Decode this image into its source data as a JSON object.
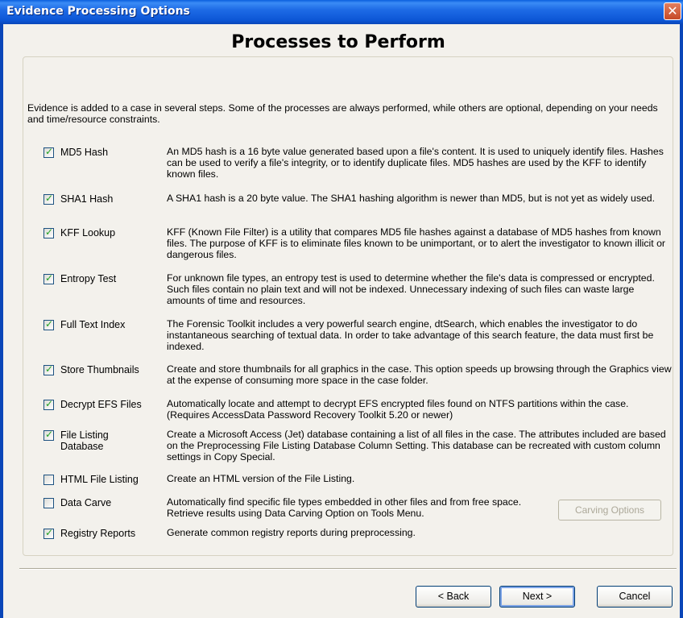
{
  "window": {
    "title": "Evidence Processing Options",
    "close_glyph": "✕"
  },
  "heading": "Processes to Perform",
  "intro": "Evidence is added to a case in several steps. Some of the processes are always performed, while others are optional, depending on your needs and time/resource constraints.",
  "options": [
    {
      "label": "MD5 Hash",
      "checked": true,
      "mark": "✓",
      "description": "An MD5 hash is a 16 byte value generated based upon a file's content. It is used to uniquely identify files. Hashes can be used to verify a file's integrity, or to identify duplicate files. MD5 hashes are used by the KFF to identify known files."
    },
    {
      "label": "SHA1 Hash",
      "checked": true,
      "mark": "✓",
      "description": "A SHA1 hash is a 20 byte value. The SHA1 hashing algorithm is newer than MD5, but is not yet as widely used."
    },
    {
      "label": "KFF Lookup",
      "checked": true,
      "mark": "✓",
      "description": "KFF (Known File Filter) is a utility that compares MD5 file hashes against a database of MD5 hashes from known files. The purpose of KFF is to eliminate files known to be unimportant, or to alert the investigator to known illicit or dangerous files."
    },
    {
      "label": "Entropy Test",
      "checked": true,
      "mark": "✓",
      "description": "For unknown file types, an entropy test is used to determine whether the file's data is compressed or encrypted. Such files contain no plain text and will not be indexed. Unnecessary indexing of such files can waste large amounts of time and resources."
    },
    {
      "label": "Full Text Index",
      "checked": true,
      "mark": "✓",
      "description": "The Forensic Toolkit includes a very powerful search engine, dtSearch, which enables the investigator to do instantaneous searching of textual data. In order to take advantage of this search feature, the data must first be indexed."
    },
    {
      "label": "Store Thumbnails",
      "checked": true,
      "mark": "✓",
      "description": "Create and store thumbnails for all graphics in the case.  This option speeds up browsing through the Graphics view at the expense of consuming more space in the case folder."
    },
    {
      "label": "Decrypt EFS Files",
      "checked": true,
      "mark": "✓",
      "description": "Automatically locate and attempt to decrypt EFS encrypted files found on NTFS partitions within the case.  (Requires AccessData Password Recovery Toolkit 5.20 or newer)"
    },
    {
      "label": "File Listing Database",
      "checked": true,
      "mark": "✓",
      "description": "Create a Microsoft Access (Jet) database containing a list of all files in the case.  The attributes included are based on the Preprocessing File Listing Database Column Setting.  This database can be recreated with custom column settings in Copy Special."
    },
    {
      "label": "HTML File Listing",
      "checked": false,
      "mark": "",
      "description": "Create an HTML version of the File Listing."
    },
    {
      "label": "Data Carve",
      "checked": false,
      "mark": "",
      "description": "Automatically find specific file types embedded in other files and from free space.  Retrieve results using Data Carving Option on Tools Menu."
    },
    {
      "label": "Registry Reports",
      "checked": true,
      "mark": "✓",
      "description": "Generate common registry reports during preprocessing."
    }
  ],
  "carving_button": "Carving Options",
  "footer": {
    "back": "< Back",
    "next": "Next >",
    "cancel": "Cancel"
  },
  "colors": {
    "titlebar": "#0A5FDE",
    "check": "#21A121",
    "dialog_bg": "#F3F1EC"
  }
}
